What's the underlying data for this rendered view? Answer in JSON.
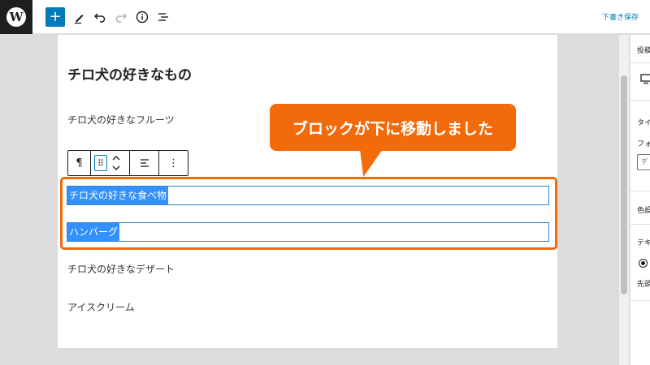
{
  "topbar": {
    "add_label": "+",
    "save_draft": "下書き保存"
  },
  "editor": {
    "heading": "チロ犬の好きなもの",
    "paragraphs": {
      "fruit": "チロ犬の好きなフルーツ",
      "food": "チロ犬の好きな食べ物",
      "hamburg": "ハンバーグ",
      "dessert": "チロ犬の好きなデザート",
      "icecream": "アイスクリーム"
    },
    "block_toolbar": {
      "paragraph_icon": "¶",
      "drag_icon": "⠿",
      "more_icon": "⋮"
    }
  },
  "callout": {
    "text": "ブロックが下に移動しました",
    "color": "#f26a0a"
  },
  "sidebar": {
    "fragments": [
      "投稿",
      "タイ",
      "フォ",
      "色設",
      "テキ",
      "先頭"
    ],
    "input_fragment": "デ"
  },
  "colors": {
    "accent": "#007cba",
    "selection": "#3390ff",
    "highlight": "#f26a0a"
  }
}
